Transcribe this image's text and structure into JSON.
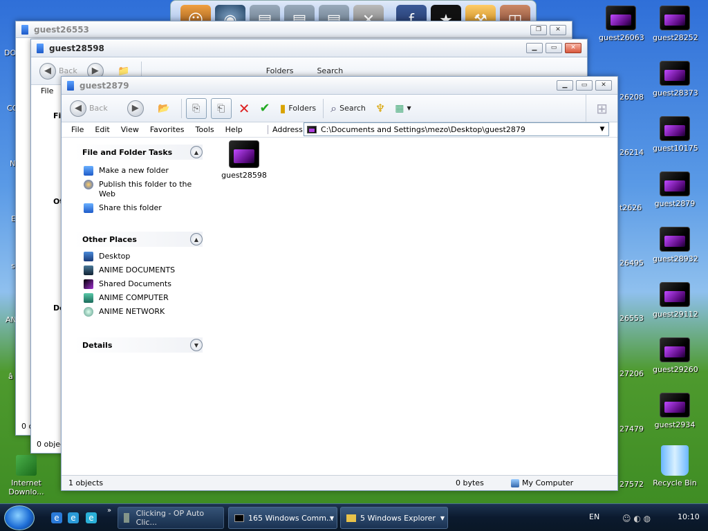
{
  "desktop": {
    "right_col1": [
      "guest26063",
      "guest26208",
      "guest26214",
      "guest2626",
      "guest26495",
      "guest26553",
      "guest27206",
      "guest27479",
      "guest27572"
    ],
    "right_col1_visible": [
      "guest26063",
      "26208",
      "26214",
      "t2626",
      "26495",
      "26553",
      "27206",
      "27479",
      "27572"
    ],
    "right_col2": [
      "guest28252",
      "guest28373",
      "guest10175",
      "guest2879",
      "guest28932",
      "guest29112",
      "guest29260",
      "guest2934",
      "Recycle Bin"
    ],
    "left_partial": [
      "DO",
      "CO",
      "N",
      "E",
      "s",
      "AN",
      "â",
      "Internet Downlo..."
    ]
  },
  "windows": {
    "back1": {
      "title": "guest26553",
      "status": "0 o"
    },
    "back2": {
      "title": "guest28598",
      "menu_file": "File",
      "back": "Back",
      "folders": "Folders",
      "search": "Search",
      "status": "0 objec",
      "side_f": "Fi",
      "side_o": "Ot",
      "side_d": "De"
    },
    "front": {
      "title": "guest2879",
      "toolbar": {
        "back": "Back",
        "folders": "Folders",
        "search": "Search"
      },
      "menu": [
        "File",
        "Edit",
        "View",
        "Favorites",
        "Tools",
        "Help"
      ],
      "address_label": "Address",
      "address_value": "C:\\Documents and Settings\\mezo\\Desktop\\guest2879",
      "tasks": {
        "header": "File and Folder Tasks",
        "items": [
          "Make a new folder",
          "Publish this folder to the Web",
          "Share this folder"
        ]
      },
      "places": {
        "header": "Other Places",
        "items": [
          "Desktop",
          "ANIME DOCUMENTS",
          "Shared Documents",
          "ANIME COMPUTER",
          "ANIME NETWORK"
        ]
      },
      "details": {
        "header": "Details"
      },
      "content_items": [
        "guest28598"
      ],
      "status": {
        "objects": "1 objects",
        "size": "0 bytes",
        "location": "My Computer"
      }
    }
  },
  "taskbar": {
    "buttons": [
      "Clicking - OP Auto Clic...",
      "165 Windows Comm...",
      "5 Windows Explorer"
    ],
    "lang": "EN",
    "time": "10:10"
  }
}
